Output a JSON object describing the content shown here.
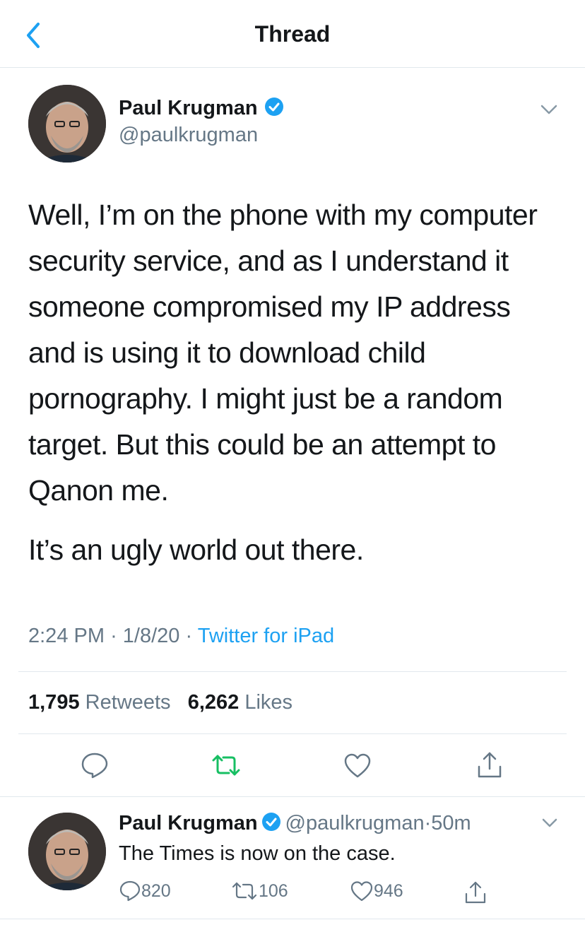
{
  "header": {
    "title": "Thread"
  },
  "main_tweet": {
    "author_name": "Paul Krugman",
    "author_handle": "@paulkrugman",
    "text_p1": "Well, I’m on the phone with my computer security service, and as I understand it someone compromised my IP address and is using it to download child pornography. I might just be a random target. But this could be an attempt to Qanon me.",
    "text_p2": "It’s an ugly world out there.",
    "time": "2:24 PM",
    "date": "1/8/20",
    "source": "Twitter for iPad",
    "retweets_count": "1,795",
    "retweets_label": "Retweets",
    "likes_count": "6,262",
    "likes_label": "Likes"
  },
  "reply_tweet": {
    "author_name": "Paul Krugman",
    "author_handle": "@paulkrugman",
    "age": "50m",
    "text": "The Times is now on the case.",
    "reply_count": "820",
    "retweet_count": "106",
    "like_count": "946"
  },
  "colors": {
    "accent": "#1da1f2",
    "retweet_green": "#17bf63",
    "muted": "#657786",
    "divider": "#e1e8ed"
  },
  "icons": [
    "back-arrow-icon",
    "verified-badge-icon",
    "chevron-down-icon",
    "reply-icon",
    "retweet-icon",
    "like-icon",
    "share-icon"
  ]
}
